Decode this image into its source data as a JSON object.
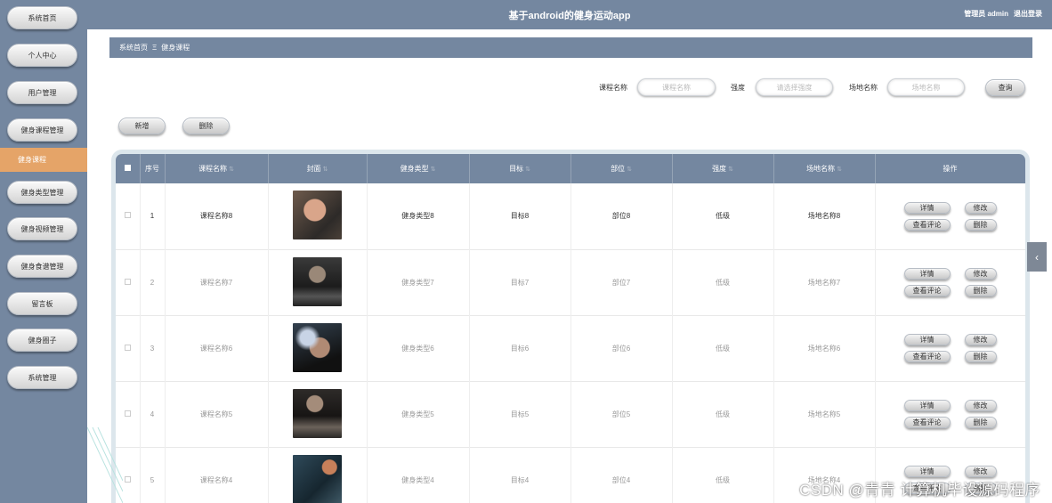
{
  "app": {
    "title": "基于android的健身运动app",
    "user": "管理员 admin",
    "logout": "退出登录"
  },
  "sidebar": {
    "items": [
      {
        "label": "系统首页"
      },
      {
        "label": "个人中心"
      },
      {
        "label": "用户管理"
      },
      {
        "label": "健身课程管理"
      },
      {
        "label": "健身类型管理"
      },
      {
        "label": "健身视频管理"
      },
      {
        "label": "健身食谱管理"
      },
      {
        "label": "留言板"
      },
      {
        "label": "健身圈子"
      },
      {
        "label": "系统管理"
      }
    ],
    "active_submenu": "健身课程"
  },
  "breadcrumb": {
    "home": "系统首页",
    "separator": "Ξ",
    "current": "健身课程"
  },
  "search": {
    "course_label": "课程名称",
    "course_placeholder": "课程名称",
    "intensity_label": "强度",
    "intensity_placeholder": "请选择强度",
    "venue_label": "场地名称",
    "venue_placeholder": "场地名称",
    "query": "查询"
  },
  "toolbar": {
    "add": "新增",
    "delete": "删除"
  },
  "table": {
    "headers": {
      "index": "序号",
      "name": "课程名称",
      "cover": "封面",
      "type": "健身类型",
      "goal": "目标",
      "part": "部位",
      "intensity": "强度",
      "venue": "场地名称",
      "actions": "操作"
    },
    "actions": {
      "detail": "详情",
      "edit": "修改",
      "comments": "查看评论",
      "delete": "删除"
    },
    "rows": [
      {
        "index": "1",
        "name": "课程名称8",
        "type": "健身类型8",
        "goal": "目标8",
        "part": "部位8",
        "intensity": "低级",
        "venue": "场地名称8"
      },
      {
        "index": "2",
        "name": "课程名称7",
        "type": "健身类型7",
        "goal": "目标7",
        "part": "部位7",
        "intensity": "低级",
        "venue": "场地名称7"
      },
      {
        "index": "3",
        "name": "课程名称6",
        "type": "健身类型6",
        "goal": "目标6",
        "part": "部位6",
        "intensity": "低级",
        "venue": "场地名称6"
      },
      {
        "index": "4",
        "name": "课程名称5",
        "type": "健身类型5",
        "goal": "目标5",
        "part": "部位5",
        "intensity": "低级",
        "venue": "场地名称5"
      },
      {
        "index": "5",
        "name": "课程名称4",
        "type": "健身类型4",
        "goal": "目标4",
        "part": "部位4",
        "intensity": "低级",
        "venue": "场地名称4"
      }
    ]
  },
  "watermark": "CSDN @青青  计算机毕设源码程序",
  "colors": {
    "primary": "#7487a0",
    "active": "#e5a468"
  }
}
